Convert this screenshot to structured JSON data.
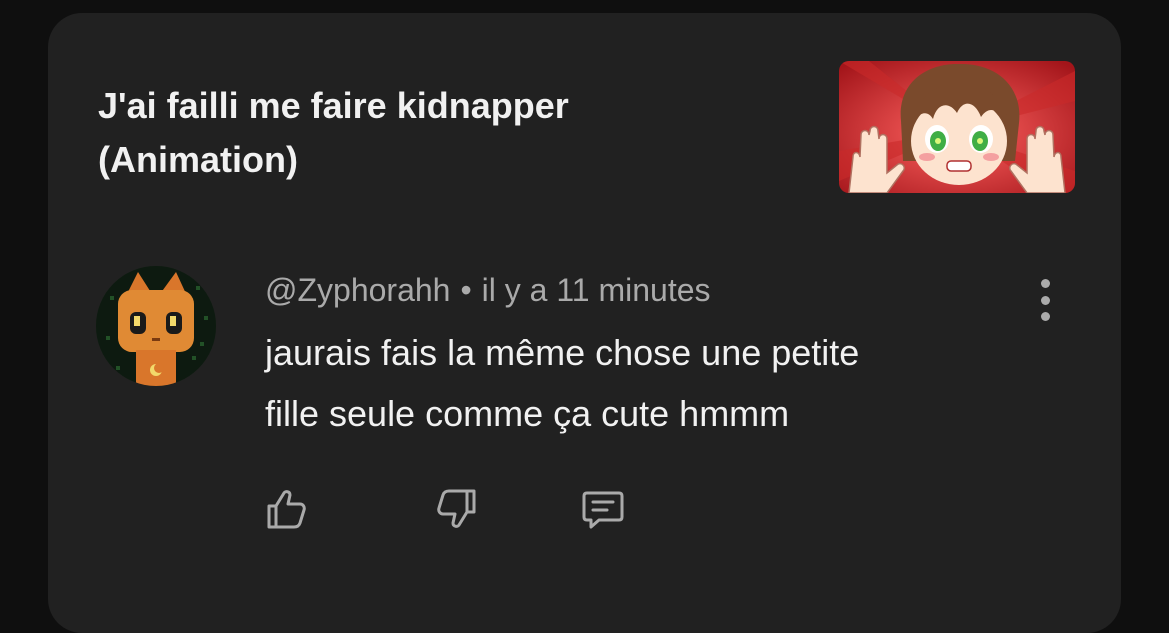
{
  "video": {
    "title": "J'ai failli me faire kidnapper\n(Animation)",
    "thumbnail_icon": "video-thumbnail"
  },
  "comment": {
    "author": "@Zyphorahh",
    "separator": "•",
    "timestamp": "il y a 11 minutes",
    "text": "jaurais  fais la même  chose une petite\nfille seule comme ça cute hmmm",
    "avatar_icon": "avatar"
  },
  "actions": {
    "like_icon": "thumb-up-icon",
    "dislike_icon": "thumb-down-icon",
    "reply_icon": "reply-icon",
    "more_icon": "more-vertical-icon"
  },
  "colors": {
    "background": "#0f0f0f",
    "card": "#212121",
    "primary_text": "#f1f1f1",
    "secondary_text": "#aaaaaa"
  }
}
